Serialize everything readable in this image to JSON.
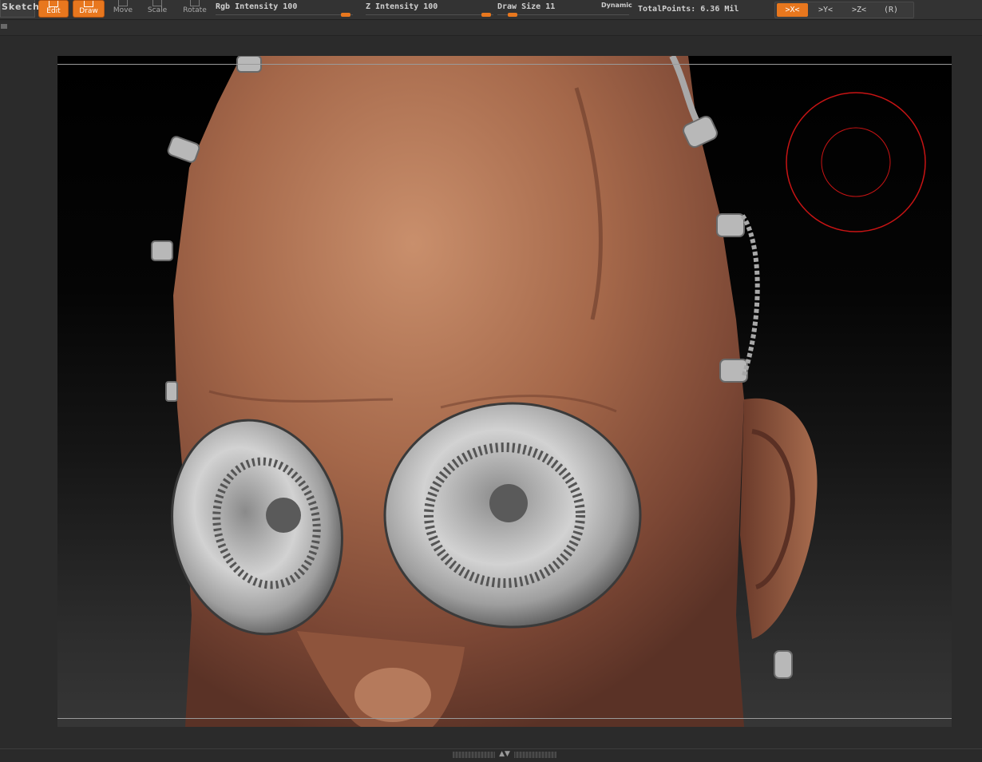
{
  "toolbar": {
    "sketch_label": "Sketch",
    "edit_label": "Edit",
    "draw_label": "Draw",
    "move_label": "Move",
    "scale_label": "Scale",
    "rotate_label": "Rotate",
    "rgb_intensity_label": "Rgb Intensity 100",
    "rgb_intensity_value": 100,
    "z_intensity_label": "Z Intensity 100",
    "z_intensity_value": 100,
    "draw_size_label": "Draw Size 11",
    "draw_size_value": 11,
    "dynamic_label": "Dynamic",
    "total_points_label": "TotalPoints: 6.36 Mil",
    "symmetry": {
      "x_label": ">X<",
      "y_label": ">Y<",
      "z_label": ">Z<",
      "r_label": "(R)",
      "active": "x"
    },
    "accent_color": "#e8771e"
  },
  "viewport": {
    "model": "head-with-mechanical-eyes",
    "brush_cursor_color": "#c81414"
  }
}
